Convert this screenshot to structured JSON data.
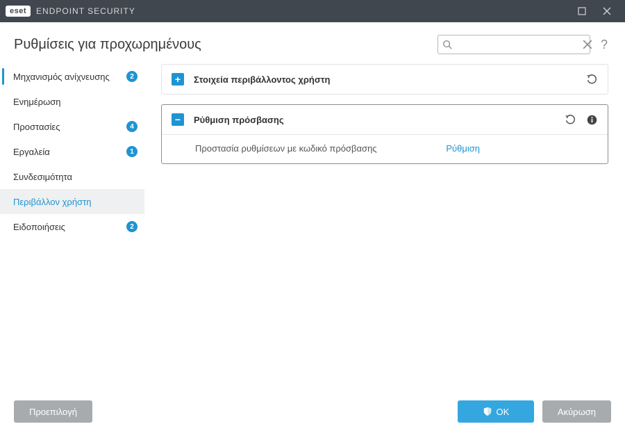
{
  "titlebar": {
    "logo_text": "eset",
    "product": "ENDPOINT SECURITY"
  },
  "header": {
    "title": "Ρυθμίσεις για προχωρημένους",
    "search_placeholder": "",
    "help_symbol": "?"
  },
  "sidebar": {
    "items": [
      {
        "label": "Μηχανισμός ανίχνευσης",
        "badge": "2",
        "marked": true,
        "active": false
      },
      {
        "label": "Ενημέρωση",
        "badge": null,
        "marked": false,
        "active": false
      },
      {
        "label": "Προστασίες",
        "badge": "4",
        "marked": false,
        "active": false
      },
      {
        "label": "Εργαλεία",
        "badge": "1",
        "marked": false,
        "active": false
      },
      {
        "label": "Συνδεσιμότητα",
        "badge": null,
        "marked": false,
        "active": false
      },
      {
        "label": "Περιβάλλον χρήστη",
        "badge": null,
        "marked": false,
        "active": true
      },
      {
        "label": "Ειδοποιήσεις",
        "badge": "2",
        "marked": false,
        "active": false
      }
    ]
  },
  "panels": {
    "ui_elements": {
      "expanded": false,
      "title": "Στοιχεία περιβάλλοντος χρήστη"
    },
    "access_setup": {
      "expanded": true,
      "title": "Ρύθμιση πρόσβασης",
      "row_label": "Προστασία ρυθμίσεων με κωδικό πρόσβασης",
      "row_action": "Ρύθμιση"
    }
  },
  "footer": {
    "default_btn": "Προεπιλογή",
    "ok_btn": "OK",
    "cancel_btn": "Ακύρωση"
  },
  "icons": {
    "expand_plus": "+",
    "expand_minus": "−"
  }
}
